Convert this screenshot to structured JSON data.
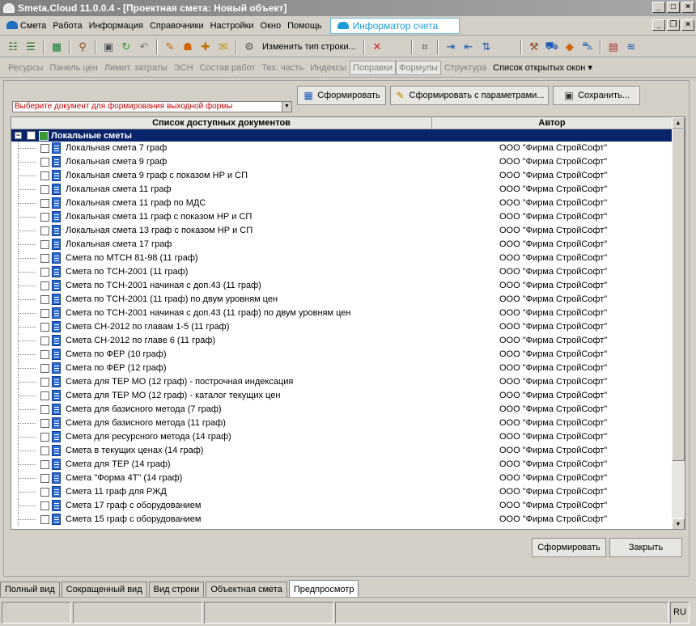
{
  "window": {
    "title": "Smeta.Cloud  11.0.0.4  - [Проектная смета: Новый объект]"
  },
  "menu": {
    "items": [
      "Смета",
      "Работа",
      "Информация",
      "Справочники",
      "Настройки",
      "Окно",
      "Помощь"
    ],
    "info_tab": "Информатор счета"
  },
  "toolbar": {
    "change_row_type": "Изменить тип строки..."
  },
  "panelbar": {
    "items": [
      "Ресурсы",
      "Панель цен",
      "Лимит. затраты",
      "ЭСН",
      "Состав работ",
      "Тех. часть",
      "Индексы",
      "Поправки",
      "Формулы",
      "Структура"
    ],
    "open_windows": "Список открытых окон ▾"
  },
  "form": {
    "doc_select_placeholder": "Выберите документ для формирования выходной формы",
    "btn_generate": "Сформировать",
    "btn_generate_params": "Сформировать с параметрами...",
    "btn_save": "Сохранить...",
    "col_docs": "Список доступных документов",
    "col_author": "Автор",
    "group_name": "Локальные сметы",
    "rows": [
      {
        "name": "Локальная смета 7 граф",
        "author": "ООО \"Фирма СтройСофт\""
      },
      {
        "name": "Локальная смета 9 граф",
        "author": "ООО \"Фирма СтройСофт\""
      },
      {
        "name": "Локальная смета 9 граф с показом НР и СП",
        "author": "ООО \"Фирма СтройСофт\""
      },
      {
        "name": "Локальная смета 11 граф",
        "author": "ООО \"Фирма СтройСофт\""
      },
      {
        "name": "Локальная смета 11 граф по МДС",
        "author": "ООО \"Фирма СтройСофт\""
      },
      {
        "name": "Локальная смета 11 граф с показом НР и СП",
        "author": "ООО \"Фирма СтройСофт\""
      },
      {
        "name": "Локальная смета 13 граф с показом НР и СП",
        "author": "ООО \"Фирма СтройСофт\""
      },
      {
        "name": "Локальная смета 17 граф",
        "author": "ООО \"Фирма СтройСофт\""
      },
      {
        "name": "Смета по МТСН 81-98 (11 граф)",
        "author": "ООО \"Фирма СтройСофт\""
      },
      {
        "name": "Смета по ТСН-2001 (11 граф)",
        "author": "ООО \"Фирма СтройСофт\""
      },
      {
        "name": "Смета по ТСН-2001 начиная с доп.43 (11 граф)",
        "author": "ООО \"Фирма СтройСофт\""
      },
      {
        "name": "Смета по ТСН-2001 (11 граф) по двум уровням цен",
        "author": "ООО \"Фирма СтройСофт\""
      },
      {
        "name": "Смета по ТСН-2001 начиная с доп.43 (11 граф) по двум уровням цен",
        "author": "ООО \"Фирма СтройСофт\""
      },
      {
        "name": "Смета СН-2012 по главам 1-5 (11 граф)",
        "author": "ООО \"Фирма СтройСофт\""
      },
      {
        "name": "Смета СН-2012 по главе 6 (11 граф)",
        "author": "ООО \"Фирма СтройСофт\""
      },
      {
        "name": "Смета по ФЕР  (10 граф)",
        "author": "ООО \"Фирма СтройСофт\""
      },
      {
        "name": "Смета по ФЕР (12 граф)",
        "author": "ООО \"Фирма СтройСофт\""
      },
      {
        "name": "Смета для ТЕР МО  (12 граф) - построчная индексация",
        "author": "ООО \"Фирма СтройСофт\""
      },
      {
        "name": "Смета для ТЕР МО  (12 граф) - каталог текущих цен",
        "author": "ООО \"Фирма СтройСофт\""
      },
      {
        "name": "Смета для базисного метода  (7 граф)",
        "author": "ООО \"Фирма СтройСофт\""
      },
      {
        "name": "Смета для базисного метода  (11 граф)",
        "author": "ООО \"Фирма СтройСофт\""
      },
      {
        "name": "Смета для ресурсного метода  (14 граф)",
        "author": "ООО \"Фирма СтройСофт\""
      },
      {
        "name": "Смета в текущих ценах  (14 граф)",
        "author": "ООО \"Фирма СтройСофт\""
      },
      {
        "name": "Смета для ТЕР  (14 граф)",
        "author": "ООО \"Фирма СтройСофт\""
      },
      {
        "name": "Смета \"Форма 4Т\"  (14 граф)",
        "author": "ООО \"Фирма СтройСофт\""
      },
      {
        "name": "Смета 11 граф для РЖД",
        "author": "ООО \"Фирма СтройСофт\""
      },
      {
        "name": "Смета 17 граф с оборудованием",
        "author": "ООО \"Фирма СтройСофт\""
      },
      {
        "name": "Смета 15 граф с оборудованием",
        "author": "ООО \"Фирма СтройСофт\""
      }
    ],
    "btn_form": "Сформировать",
    "btn_close": "Закрыть"
  },
  "view_tabs": [
    "Полный вид",
    "Сокращенный вид",
    "Вид строки",
    "Объектная смета",
    "Предпросмотр"
  ],
  "status": {
    "lang": "RU"
  }
}
